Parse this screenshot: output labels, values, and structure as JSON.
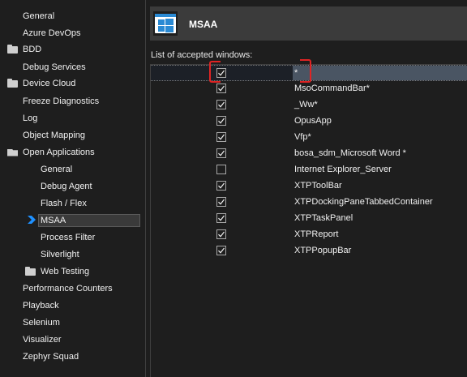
{
  "sidebar": {
    "items": [
      {
        "label": "General",
        "icon": ""
      },
      {
        "label": "Azure DevOps",
        "icon": ""
      },
      {
        "label": "BDD",
        "icon": "folder-icon"
      },
      {
        "label": "Debug Services",
        "icon": ""
      },
      {
        "label": "Device Cloud",
        "icon": "folder-icon"
      },
      {
        "label": "Freeze Diagnostics",
        "icon": ""
      },
      {
        "label": "Log",
        "icon": ""
      },
      {
        "label": "Object Mapping",
        "icon": ""
      },
      {
        "label": "Open Applications",
        "icon": "folder-open-icon"
      },
      {
        "label": "General",
        "icon": ""
      },
      {
        "label": "Debug Agent",
        "icon": ""
      },
      {
        "label": "Flash / Flex",
        "icon": ""
      },
      {
        "label": "MSAA",
        "icon": "selected-arrow-icon"
      },
      {
        "label": "Process Filter",
        "icon": ""
      },
      {
        "label": "Silverlight",
        "icon": ""
      },
      {
        "label": "Web Testing",
        "icon": "folder-icon"
      },
      {
        "label": "Performance Counters",
        "icon": ""
      },
      {
        "label": "Playback",
        "icon": ""
      },
      {
        "label": "Selenium",
        "icon": ""
      },
      {
        "label": "Visualizer",
        "icon": ""
      },
      {
        "label": "Zephyr Squad",
        "icon": ""
      }
    ]
  },
  "header": {
    "title": "MSAA",
    "icon": "windows-logo-icon"
  },
  "main": {
    "list_label": "List of accepted windows:",
    "rows": [
      {
        "name": "*",
        "checked": true
      },
      {
        "name": "MsoCommandBar*",
        "checked": true
      },
      {
        "name": "_Ww*",
        "checked": true
      },
      {
        "name": "OpusApp",
        "checked": true
      },
      {
        "name": "Vfp*",
        "checked": true
      },
      {
        "name": "bosa_sdm_Microsoft Word *",
        "checked": true
      },
      {
        "name": "Internet Explorer_Server",
        "checked": false
      },
      {
        "name": "XTPToolBar",
        "checked": true
      },
      {
        "name": "XTPDockingPaneTabbedContainer",
        "checked": true
      },
      {
        "name": "XTPTaskPanel",
        "checked": true
      },
      {
        "name": "XTPReport",
        "checked": true
      },
      {
        "name": "XTPPopupBar",
        "checked": true
      }
    ]
  },
  "colors": {
    "accent": "#1e90ff",
    "highlight": "#e02424",
    "background": "#1e1e1e"
  }
}
